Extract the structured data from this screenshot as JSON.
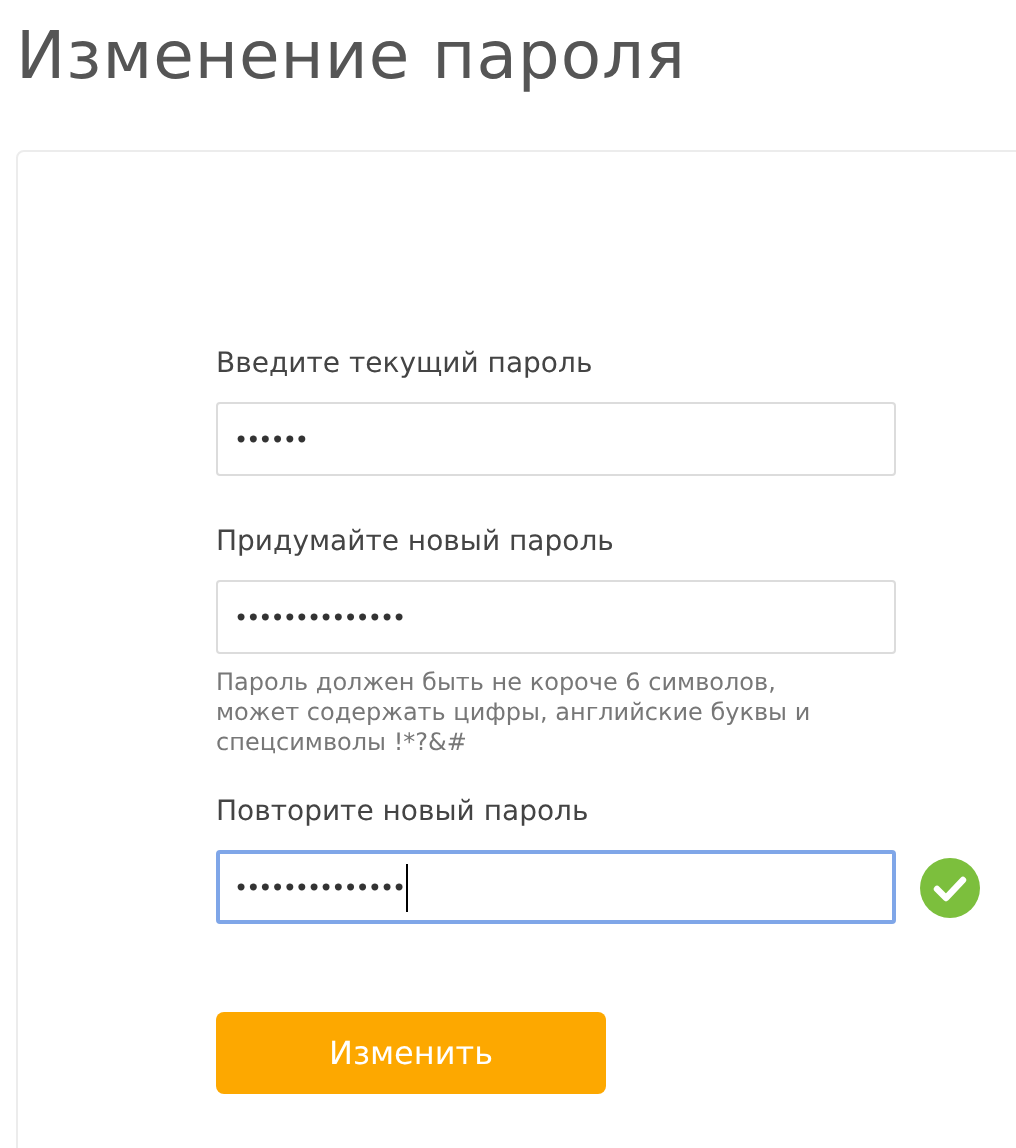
{
  "title": "Изменение пароля",
  "fields": [
    {
      "label": "Введите текущий пароль",
      "value": "••••••",
      "focused": false,
      "valid": false
    },
    {
      "label": "Придумайте новый пароль",
      "value": "••••••••••••••",
      "focused": false,
      "valid": false,
      "hint": "Пароль должен быть не короче 6 символов, может содержать цифры, английские буквы и спецсимволы !*?&#"
    },
    {
      "label": "Повторите новый пароль",
      "value": "••••••••••••••",
      "focused": true,
      "valid": true
    }
  ],
  "submit": "Изменить"
}
